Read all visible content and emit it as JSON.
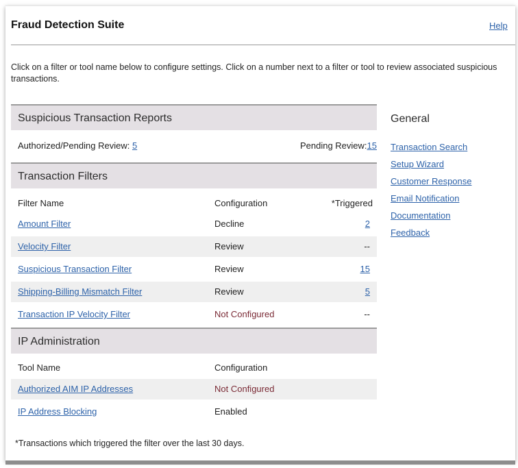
{
  "header": {
    "title": "Fraud Detection Suite",
    "help_label": "Help"
  },
  "intro_text": "Click on a filter or tool name below to configure settings. Click on a number next to a filter or tool to review associated suspicious transactions.",
  "reports": {
    "title": "Suspicious Transaction Reports",
    "authorized_label": "Authorized/Pending Review:",
    "authorized_count": "5",
    "pending_label": "Pending Review:",
    "pending_count": "15"
  },
  "filters": {
    "title": "Transaction Filters",
    "columns": [
      "Filter Name",
      "Configuration",
      "*Triggered"
    ],
    "rows": [
      {
        "name": "Amount Filter",
        "config": "Decline",
        "triggered": "2"
      },
      {
        "name": "Velocity Filter",
        "config": "Review",
        "triggered": "--"
      },
      {
        "name": "Suspicious Transaction Filter",
        "config": "Review",
        "triggered": "15"
      },
      {
        "name": "Shipping-Billing Mismatch Filter",
        "config": "Review",
        "triggered": "5"
      },
      {
        "name": "Transaction IP Velocity Filter",
        "config": "Not Configured",
        "triggered": "--"
      }
    ]
  },
  "ip_admin": {
    "title": "IP Administration",
    "columns": [
      "Tool Name",
      "Configuration"
    ],
    "rows": [
      {
        "name": "Authorized AIM IP Addresses",
        "config": "Not Configured"
      },
      {
        "name": "IP Address Blocking",
        "config": "Enabled"
      }
    ]
  },
  "general": {
    "title": "General",
    "links": [
      "Transaction Search",
      "Setup Wizard",
      "Customer Response",
      "Email Notification",
      "Documentation",
      "Feedback"
    ]
  },
  "footnote": "*Transactions which triggered the filter over the last 30 days.",
  "colors": {
    "link": "#2d62a9",
    "not_configured": "#7a2a35",
    "section_header_bg": "#e4e0e4"
  }
}
